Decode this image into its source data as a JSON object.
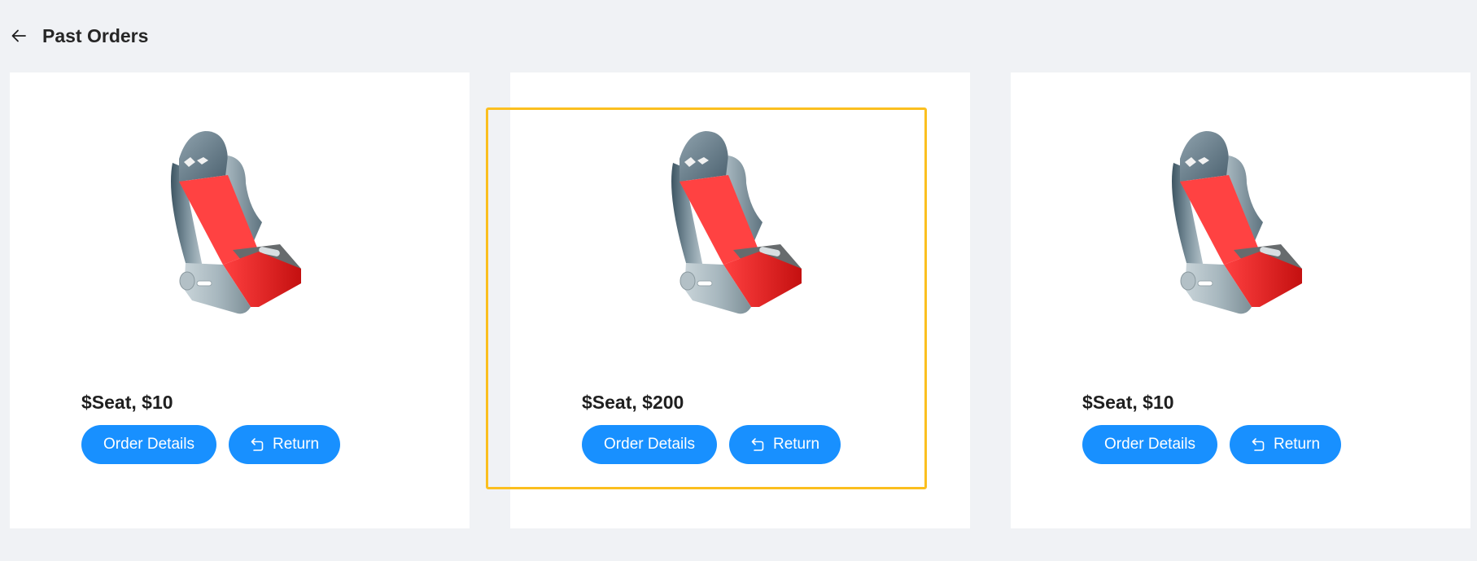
{
  "header": {
    "back_icon": "arrow-left-icon",
    "title": "Past Orders"
  },
  "colors": {
    "background": "#f0f2f5",
    "primary": "#1890ff",
    "highlight": "#fbbf1f"
  },
  "orders": [
    {
      "title": "$Seat, $10",
      "details_label": "Order Details",
      "return_label": "Return",
      "image": "car-seat-image",
      "return_icon": "return-icon"
    },
    {
      "title": "$Seat, $200",
      "details_label": "Order Details",
      "return_label": "Return",
      "image": "car-seat-image",
      "return_icon": "return-icon",
      "highlighted": true
    },
    {
      "title": "$Seat, $10",
      "details_label": "Order Details",
      "return_label": "Return",
      "image": "car-seat-image",
      "return_icon": "return-icon"
    }
  ]
}
